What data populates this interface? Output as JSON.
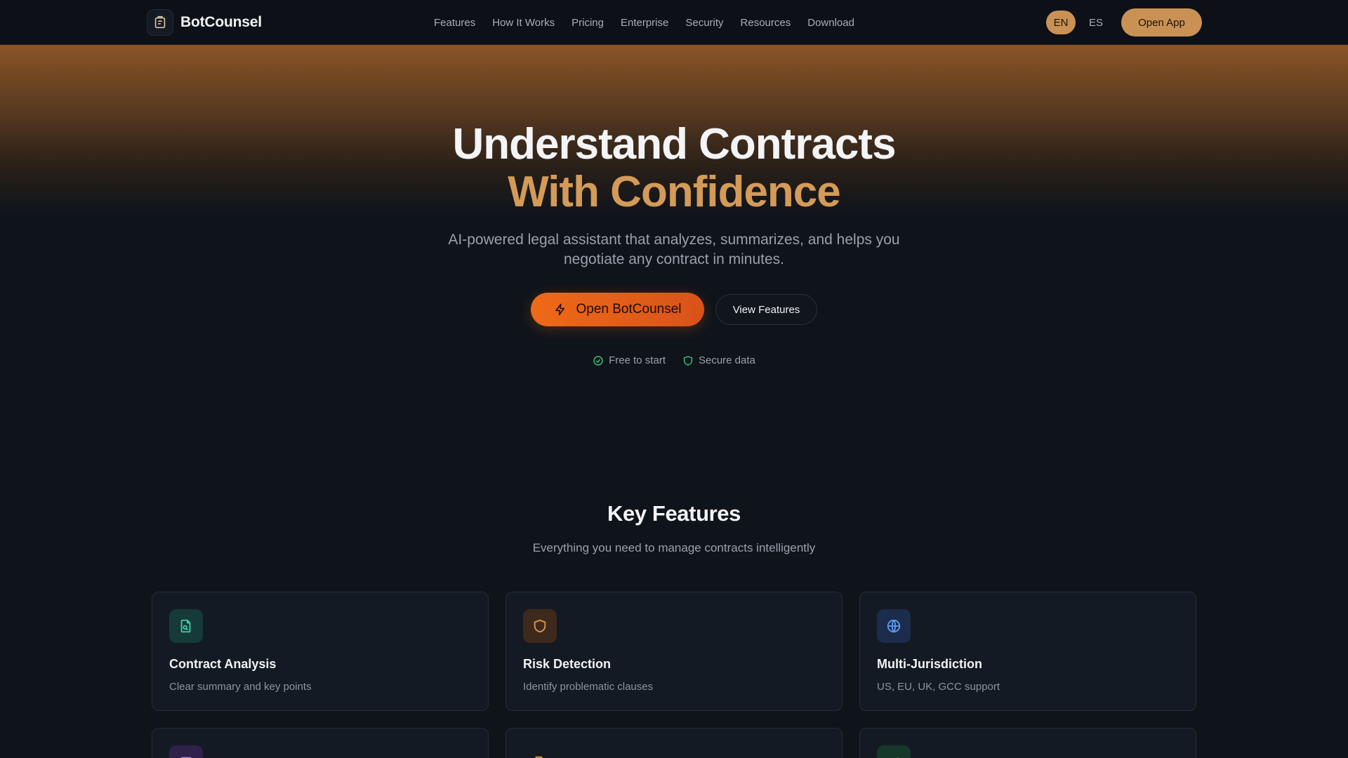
{
  "brand": {
    "name": "BotCounsel"
  },
  "nav": {
    "links": [
      "Features",
      "How It Works",
      "Pricing",
      "Enterprise",
      "Security",
      "Resources",
      "Download"
    ],
    "languages": [
      "EN",
      "ES"
    ],
    "active_language": "EN",
    "open_app_label": "Open App"
  },
  "hero": {
    "title_line1": "Understand Contracts",
    "title_line2": "With Confidence",
    "subtitle": "AI-powered legal assistant that analyzes, summarizes, and helps you negotiate any contract in minutes.",
    "primary_cta": "Open BotCounsel",
    "secondary_cta": "View Features",
    "badges": [
      "Free to start",
      "Secure data"
    ]
  },
  "features": {
    "title": "Key Features",
    "subtitle": "Everything you need to manage contracts intelligently",
    "cards": [
      {
        "title": "Contract Analysis",
        "desc": "Clear summary and key points",
        "icon": "document-search-icon",
        "color": "#3ccfa6",
        "bg": "#153a37"
      },
      {
        "title": "Risk Detection",
        "desc": "Identify problematic clauses",
        "icon": "shield-icon",
        "color": "#e8974a",
        "bg": "#3d2a1d"
      },
      {
        "title": "Multi-Jurisdiction",
        "desc": "US, EU, UK, GCC support",
        "icon": "globe-icon",
        "color": "#5c9cf0",
        "bg": "#1c2c4c"
      }
    ],
    "partial_cards": [
      {
        "icon": "message-icon",
        "color": "#b07ae8",
        "bg": "#30214a"
      },
      {
        "icon": "file-edit-icon",
        "color": "#e8974a",
        "bg": "#141a23"
      },
      {
        "icon": "leaf-icon",
        "color": "#3cc07a",
        "bg": "#16382a"
      }
    ]
  },
  "colors": {
    "accent": "#c99254",
    "cta": "#ee6a18",
    "background": "#0f141b"
  }
}
